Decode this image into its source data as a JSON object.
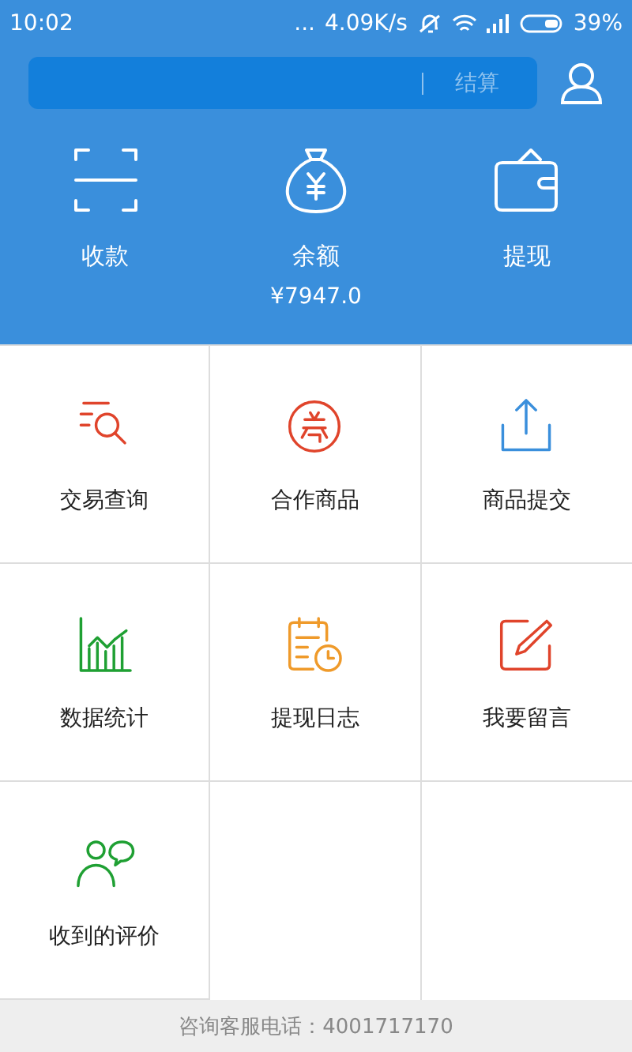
{
  "status_bar": {
    "time": "10:02",
    "dots": "...",
    "speed": "4.09K/s",
    "battery": "39%"
  },
  "search": {
    "button": "结算"
  },
  "actions": [
    {
      "label": "收款"
    },
    {
      "label": "余额",
      "amount": "¥7947.0"
    },
    {
      "label": "提现"
    }
  ],
  "grid": [
    {
      "label": "交易查询"
    },
    {
      "label": "合作商品"
    },
    {
      "label": "商品提交"
    },
    {
      "label": "数据统计"
    },
    {
      "label": "提现日志"
    },
    {
      "label": "我要留言"
    },
    {
      "label": "收到的评价"
    }
  ],
  "footer": {
    "text": "咨询客服电话：4001717170"
  }
}
